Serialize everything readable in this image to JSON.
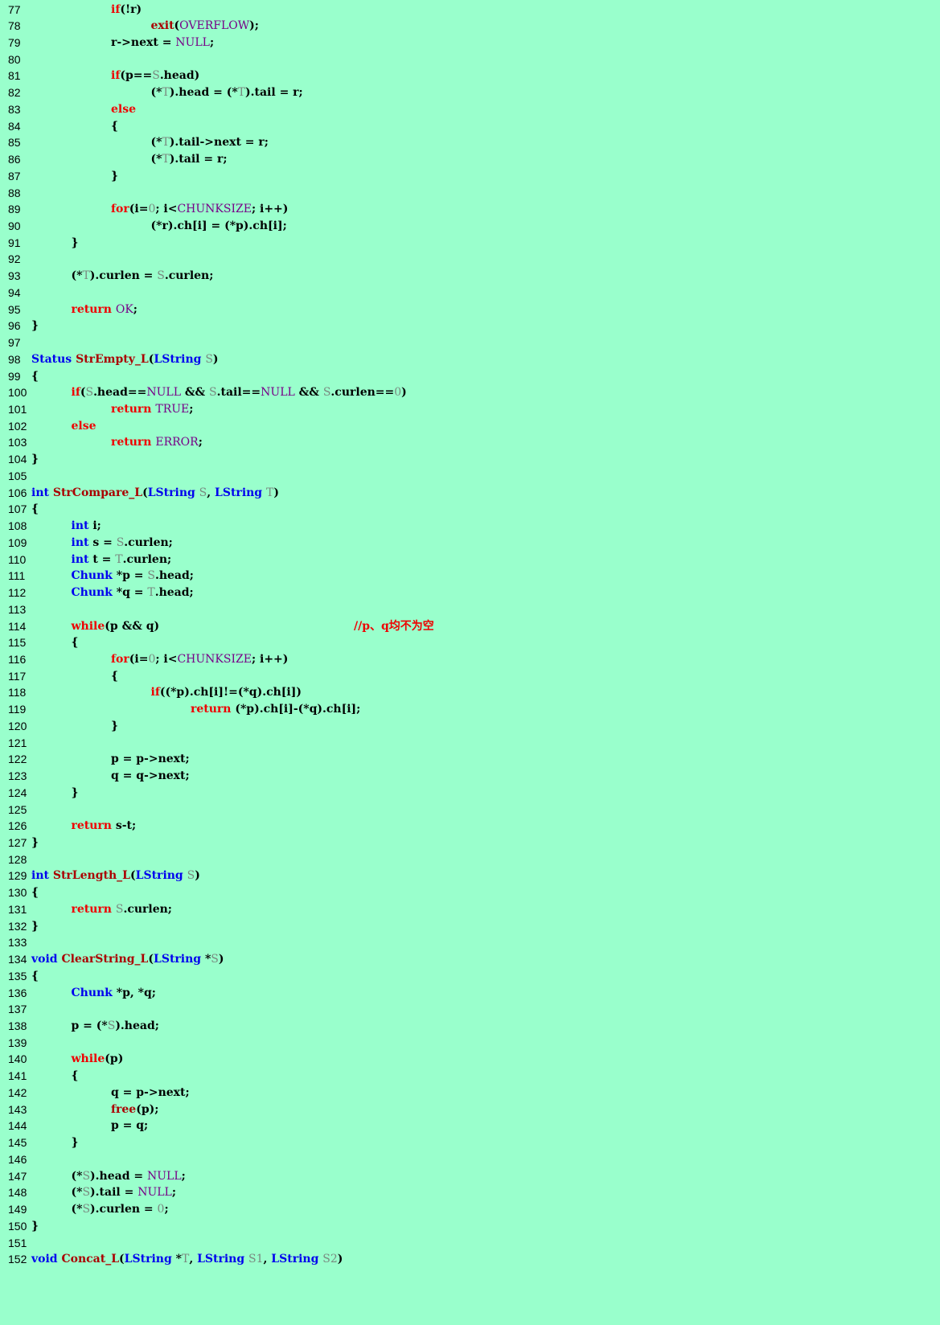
{
  "editor": {
    "tab_size": 4,
    "palette": {
      "background": "#99ffcc",
      "keyword": "#ee0000",
      "type": "#0000ee",
      "function": "#aa0000",
      "constant": "#770088",
      "parameter": "#7a8a80",
      "comment": "#ee0000",
      "default": "#000000"
    },
    "lines": [
      {
        "n": "77",
        "indent": 2,
        "toks": [
          [
            "kw",
            "if"
          ],
          [
            "op",
            "(!r)"
          ]
        ]
      },
      {
        "n": "78",
        "indent": 3,
        "toks": [
          [
            "fn",
            "exit"
          ],
          [
            "op",
            "("
          ],
          [
            "cn",
            "OVERFLOW"
          ],
          [
            "op",
            ");"
          ]
        ]
      },
      {
        "n": "79",
        "indent": 2,
        "toks": [
          [
            "op",
            "r->next = "
          ],
          [
            "cn",
            "NULL"
          ],
          [
            "op",
            ";"
          ]
        ]
      },
      {
        "n": "80",
        "indent": 0,
        "toks": []
      },
      {
        "n": "81",
        "indent": 2,
        "toks": [
          [
            "kw",
            "if"
          ],
          [
            "op",
            "(p=="
          ],
          [
            "pm",
            "S"
          ],
          [
            "op",
            ".head)"
          ]
        ]
      },
      {
        "n": "82",
        "indent": 3,
        "toks": [
          [
            "op",
            "(*"
          ],
          [
            "pm",
            "T"
          ],
          [
            "op",
            ").head = (*"
          ],
          [
            "pm",
            "T"
          ],
          [
            "op",
            ").tail = r;"
          ]
        ]
      },
      {
        "n": "83",
        "indent": 2,
        "toks": [
          [
            "kw",
            "else"
          ]
        ]
      },
      {
        "n": "84",
        "indent": 2,
        "toks": [
          [
            "op",
            "{"
          ]
        ]
      },
      {
        "n": "85",
        "indent": 3,
        "toks": [
          [
            "op",
            "(*"
          ],
          [
            "pm",
            "T"
          ],
          [
            "op",
            ").tail->next = r;"
          ]
        ]
      },
      {
        "n": "86",
        "indent": 3,
        "toks": [
          [
            "op",
            "(*"
          ],
          [
            "pm",
            "T"
          ],
          [
            "op",
            ").tail = r;"
          ]
        ]
      },
      {
        "n": "87",
        "indent": 2,
        "toks": [
          [
            "op",
            "}"
          ]
        ]
      },
      {
        "n": "88",
        "indent": 0,
        "toks": []
      },
      {
        "n": "89",
        "indent": 2,
        "toks": [
          [
            "kw",
            "for"
          ],
          [
            "op",
            "(i="
          ],
          [
            "nm",
            "0"
          ],
          [
            "op",
            "; i<"
          ],
          [
            "cn",
            "CHUNKSIZE"
          ],
          [
            "op",
            "; i++)"
          ]
        ]
      },
      {
        "n": "90",
        "indent": 3,
        "toks": [
          [
            "op",
            "(*r).ch[i] = (*p).ch[i];"
          ]
        ]
      },
      {
        "n": "91",
        "indent": 1,
        "toks": [
          [
            "op",
            "}"
          ]
        ]
      },
      {
        "n": "92",
        "indent": 0,
        "toks": []
      },
      {
        "n": "93",
        "indent": 1,
        "toks": [
          [
            "op",
            "(*"
          ],
          [
            "pm",
            "T"
          ],
          [
            "op",
            ").curlen = "
          ],
          [
            "pm",
            "S"
          ],
          [
            "op",
            ".curlen;"
          ]
        ]
      },
      {
        "n": "94",
        "indent": 0,
        "toks": []
      },
      {
        "n": "95",
        "indent": 1,
        "toks": [
          [
            "kw",
            "return"
          ],
          [
            "op",
            " "
          ],
          [
            "cn",
            "OK"
          ],
          [
            "op",
            ";"
          ]
        ]
      },
      {
        "n": "96",
        "indent": 0,
        "toks": [
          [
            "op",
            "}"
          ]
        ]
      },
      {
        "n": "97",
        "indent": 0,
        "toks": []
      },
      {
        "n": "98",
        "indent": 0,
        "toks": [
          [
            "ty",
            "Status"
          ],
          [
            "op",
            " "
          ],
          [
            "fn",
            "StrEmpty_L"
          ],
          [
            "op",
            "("
          ],
          [
            "ty",
            "LString"
          ],
          [
            "op",
            " "
          ],
          [
            "pm",
            "S"
          ],
          [
            "op",
            ")"
          ]
        ]
      },
      {
        "n": "99",
        "indent": 0,
        "toks": [
          [
            "op",
            "{"
          ]
        ]
      },
      {
        "n": "100",
        "indent": 1,
        "toks": [
          [
            "kw",
            "if"
          ],
          [
            "op",
            "("
          ],
          [
            "pm",
            "S"
          ],
          [
            "op",
            ".head=="
          ],
          [
            "cn",
            "NULL"
          ],
          [
            "op",
            " && "
          ],
          [
            "pm",
            "S"
          ],
          [
            "op",
            ".tail=="
          ],
          [
            "cn",
            "NULL"
          ],
          [
            "op",
            " && "
          ],
          [
            "pm",
            "S"
          ],
          [
            "op",
            ".curlen=="
          ],
          [
            "nm",
            "0"
          ],
          [
            "op",
            ")"
          ]
        ]
      },
      {
        "n": "101",
        "indent": 2,
        "toks": [
          [
            "kw",
            "return"
          ],
          [
            "op",
            " "
          ],
          [
            "cn",
            "TRUE"
          ],
          [
            "op",
            ";"
          ]
        ]
      },
      {
        "n": "102",
        "indent": 1,
        "toks": [
          [
            "kw",
            "else"
          ]
        ]
      },
      {
        "n": "103",
        "indent": 2,
        "toks": [
          [
            "kw",
            "return"
          ],
          [
            "op",
            " "
          ],
          [
            "cn",
            "ERROR"
          ],
          [
            "op",
            ";"
          ]
        ]
      },
      {
        "n": "104",
        "indent": 0,
        "toks": [
          [
            "op",
            "}"
          ]
        ]
      },
      {
        "n": "105",
        "indent": 0,
        "toks": []
      },
      {
        "n": "106",
        "indent": 0,
        "toks": [
          [
            "ty",
            "int"
          ],
          [
            "op",
            " "
          ],
          [
            "fn",
            "StrCompare_L"
          ],
          [
            "op",
            "("
          ],
          [
            "ty",
            "LString"
          ],
          [
            "op",
            " "
          ],
          [
            "pm",
            "S"
          ],
          [
            "op",
            ", "
          ],
          [
            "ty",
            "LString"
          ],
          [
            "op",
            " "
          ],
          [
            "pm",
            "T"
          ],
          [
            "op",
            ")"
          ]
        ]
      },
      {
        "n": "107",
        "indent": 0,
        "toks": [
          [
            "op",
            "{"
          ]
        ]
      },
      {
        "n": "108",
        "indent": 1,
        "toks": [
          [
            "ty",
            "int"
          ],
          [
            "op",
            " i;"
          ]
        ]
      },
      {
        "n": "109",
        "indent": 1,
        "toks": [
          [
            "ty",
            "int"
          ],
          [
            "op",
            " s = "
          ],
          [
            "pm",
            "S"
          ],
          [
            "op",
            ".curlen;"
          ]
        ]
      },
      {
        "n": "110",
        "indent": 1,
        "toks": [
          [
            "ty",
            "int"
          ],
          [
            "op",
            " t = "
          ],
          [
            "pm",
            "T"
          ],
          [
            "op",
            ".curlen;"
          ]
        ]
      },
      {
        "n": "111",
        "indent": 1,
        "toks": [
          [
            "ty",
            "Chunk"
          ],
          [
            "op",
            " *p = "
          ],
          [
            "pm",
            "S"
          ],
          [
            "op",
            ".head;"
          ]
        ]
      },
      {
        "n": "112",
        "indent": 1,
        "toks": [
          [
            "ty",
            "Chunk"
          ],
          [
            "op",
            " *q = "
          ],
          [
            "pm",
            "T"
          ],
          [
            "op",
            ".head;"
          ]
        ]
      },
      {
        "n": "113",
        "indent": 0,
        "toks": []
      },
      {
        "n": "114",
        "indent": 1,
        "toks": [
          [
            "kw",
            "while"
          ],
          [
            "op",
            "(p && q)"
          ]
        ],
        "comment": "//p、q均不为空"
      },
      {
        "n": "115",
        "indent": 1,
        "toks": [
          [
            "op",
            "{"
          ]
        ]
      },
      {
        "n": "116",
        "indent": 2,
        "toks": [
          [
            "kw",
            "for"
          ],
          [
            "op",
            "(i="
          ],
          [
            "nm",
            "0"
          ],
          [
            "op",
            "; i<"
          ],
          [
            "cn",
            "CHUNKSIZE"
          ],
          [
            "op",
            "; i++)"
          ]
        ]
      },
      {
        "n": "117",
        "indent": 2,
        "toks": [
          [
            "op",
            "{"
          ]
        ]
      },
      {
        "n": "118",
        "indent": 3,
        "toks": [
          [
            "kw",
            "if"
          ],
          [
            "op",
            "((*p).ch[i]!=(*q).ch[i])"
          ]
        ]
      },
      {
        "n": "119",
        "indent": 4,
        "toks": [
          [
            "kw",
            "return"
          ],
          [
            "op",
            " (*p).ch[i]-(*q).ch[i];"
          ]
        ]
      },
      {
        "n": "120",
        "indent": 2,
        "toks": [
          [
            "op",
            "}"
          ]
        ]
      },
      {
        "n": "121",
        "indent": 0,
        "toks": []
      },
      {
        "n": "122",
        "indent": 2,
        "toks": [
          [
            "op",
            "p = p->next;"
          ]
        ]
      },
      {
        "n": "123",
        "indent": 2,
        "toks": [
          [
            "op",
            "q = q->next;"
          ]
        ]
      },
      {
        "n": "124",
        "indent": 1,
        "toks": [
          [
            "op",
            "}"
          ]
        ]
      },
      {
        "n": "125",
        "indent": 0,
        "toks": []
      },
      {
        "n": "126",
        "indent": 1,
        "toks": [
          [
            "kw",
            "return"
          ],
          [
            "op",
            " s-t;"
          ]
        ]
      },
      {
        "n": "127",
        "indent": 0,
        "toks": [
          [
            "op",
            "}"
          ]
        ]
      },
      {
        "n": "128",
        "indent": 0,
        "toks": []
      },
      {
        "n": "129",
        "indent": 0,
        "toks": [
          [
            "ty",
            "int"
          ],
          [
            "op",
            " "
          ],
          [
            "fn",
            "StrLength_L"
          ],
          [
            "op",
            "("
          ],
          [
            "ty",
            "LString"
          ],
          [
            "op",
            " "
          ],
          [
            "pm",
            "S"
          ],
          [
            "op",
            ")"
          ]
        ]
      },
      {
        "n": "130",
        "indent": 0,
        "toks": [
          [
            "op",
            "{"
          ]
        ]
      },
      {
        "n": "131",
        "indent": 1,
        "toks": [
          [
            "kw",
            "return"
          ],
          [
            "op",
            " "
          ],
          [
            "pm",
            "S"
          ],
          [
            "op",
            ".curlen;"
          ]
        ]
      },
      {
        "n": "132",
        "indent": 0,
        "toks": [
          [
            "op",
            "}"
          ]
        ]
      },
      {
        "n": "133",
        "indent": 0,
        "toks": []
      },
      {
        "n": "134",
        "indent": 0,
        "toks": [
          [
            "ty",
            "void"
          ],
          [
            "op",
            " "
          ],
          [
            "fn",
            "ClearString_L"
          ],
          [
            "op",
            "("
          ],
          [
            "ty",
            "LString"
          ],
          [
            "op",
            " *"
          ],
          [
            "pm",
            "S"
          ],
          [
            "op",
            ")"
          ]
        ]
      },
      {
        "n": "135",
        "indent": 0,
        "toks": [
          [
            "op",
            "{"
          ]
        ]
      },
      {
        "n": "136",
        "indent": 1,
        "toks": [
          [
            "ty",
            "Chunk"
          ],
          [
            "op",
            " *p, *q;"
          ]
        ]
      },
      {
        "n": "137",
        "indent": 0,
        "toks": []
      },
      {
        "n": "138",
        "indent": 1,
        "toks": [
          [
            "op",
            "p = (*"
          ],
          [
            "pm",
            "S"
          ],
          [
            "op",
            ").head;"
          ]
        ]
      },
      {
        "n": "139",
        "indent": 0,
        "toks": []
      },
      {
        "n": "140",
        "indent": 1,
        "toks": [
          [
            "kw",
            "while"
          ],
          [
            "op",
            "(p)"
          ]
        ]
      },
      {
        "n": "141",
        "indent": 1,
        "toks": [
          [
            "op",
            "{"
          ]
        ]
      },
      {
        "n": "142",
        "indent": 2,
        "toks": [
          [
            "op",
            "q = p->next;"
          ]
        ]
      },
      {
        "n": "143",
        "indent": 2,
        "toks": [
          [
            "fn",
            "free"
          ],
          [
            "op",
            "(p);"
          ]
        ]
      },
      {
        "n": "144",
        "indent": 2,
        "toks": [
          [
            "op",
            "p = q;"
          ]
        ]
      },
      {
        "n": "145",
        "indent": 1,
        "toks": [
          [
            "op",
            "}"
          ]
        ]
      },
      {
        "n": "146",
        "indent": 0,
        "toks": []
      },
      {
        "n": "147",
        "indent": 1,
        "toks": [
          [
            "op",
            "(*"
          ],
          [
            "pm",
            "S"
          ],
          [
            "op",
            ").head = "
          ],
          [
            "cn",
            "NULL"
          ],
          [
            "op",
            ";"
          ]
        ]
      },
      {
        "n": "148",
        "indent": 1,
        "toks": [
          [
            "op",
            "(*"
          ],
          [
            "pm",
            "S"
          ],
          [
            "op",
            ").tail = "
          ],
          [
            "cn",
            "NULL"
          ],
          [
            "op",
            ";"
          ]
        ]
      },
      {
        "n": "149",
        "indent": 1,
        "toks": [
          [
            "op",
            "(*"
          ],
          [
            "pm",
            "S"
          ],
          [
            "op",
            ").curlen = "
          ],
          [
            "nm",
            "0"
          ],
          [
            "op",
            ";"
          ]
        ]
      },
      {
        "n": "150",
        "indent": 0,
        "toks": [
          [
            "op",
            "}"
          ]
        ]
      },
      {
        "n": "151",
        "indent": 0,
        "toks": []
      },
      {
        "n": "152",
        "indent": 0,
        "toks": [
          [
            "ty",
            "void"
          ],
          [
            "op",
            " "
          ],
          [
            "fn",
            "Concat_L"
          ],
          [
            "op",
            "("
          ],
          [
            "ty",
            "LString"
          ],
          [
            "op",
            " *"
          ],
          [
            "pm",
            "T"
          ],
          [
            "op",
            ", "
          ],
          [
            "ty",
            "LString"
          ],
          [
            "op",
            " "
          ],
          [
            "pm",
            "S1"
          ],
          [
            "op",
            ", "
          ],
          [
            "ty",
            "LString"
          ],
          [
            "op",
            " "
          ],
          [
            "pm",
            "S2"
          ],
          [
            "op",
            ")"
          ]
        ]
      }
    ]
  }
}
